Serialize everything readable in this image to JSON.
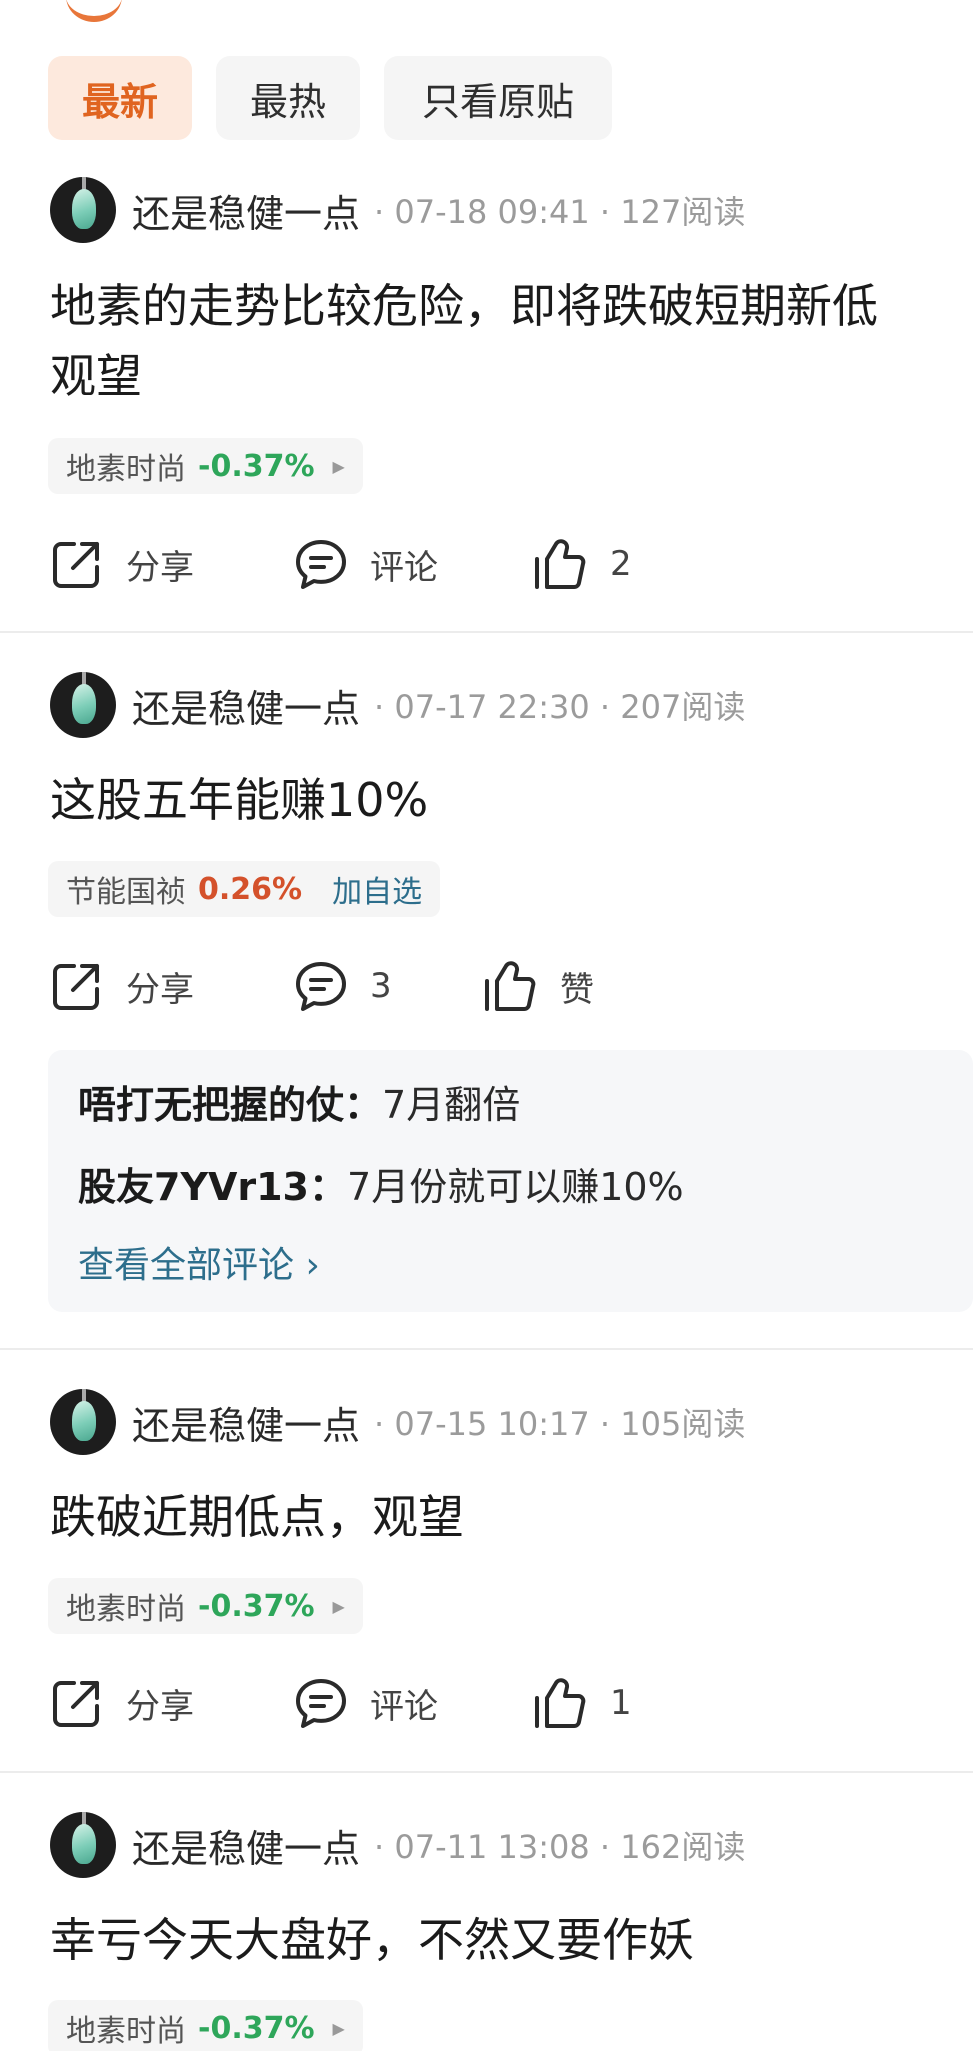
{
  "tabs": [
    {
      "label": "最新",
      "active": true
    },
    {
      "label": "最热",
      "active": false
    },
    {
      "label": "只看原贴",
      "active": false
    }
  ],
  "posts": [
    {
      "author": "还是稳健一点",
      "meta": "· 07-18 09:41 · 127阅读",
      "text_lines": [
        "地素的走势比较危险，即将跌破短期新低",
        "观望"
      ],
      "stock": {
        "name": "地素时尚",
        "change": "-0.37%",
        "direction": "down",
        "arrow": "▶"
      },
      "actions": {
        "share": "分享",
        "comment": "评论",
        "like": "2"
      }
    },
    {
      "author": "还是稳健一点",
      "meta": "· 07-17 22:30 · 207阅读",
      "text_lines": [
        "这股五年能赚10%"
      ],
      "stock": {
        "name": "节能国祯",
        "change": "0.26%",
        "direction": "up",
        "watch": "加自选"
      },
      "actions": {
        "share": "分享",
        "comment": "3",
        "like": "赞"
      },
      "comments": [
        {
          "user": "唔打无把握的仗",
          "sep": "：",
          "text": "7月翻倍"
        },
        {
          "user": "股友7YVr13",
          "sep": "：",
          "text": "7月份就可以赚10%"
        }
      ],
      "view_all": "查看全部评论 ›"
    },
    {
      "author": "还是稳健一点",
      "meta": "· 07-15 10:17 · 105阅读",
      "text_lines": [
        "跌破近期低点，观望"
      ],
      "stock": {
        "name": "地素时尚",
        "change": "-0.37%",
        "direction": "down",
        "arrow": "▶"
      },
      "actions": {
        "share": "分享",
        "comment": "评论",
        "like": "1"
      }
    },
    {
      "author": "还是稳健一点",
      "meta": "· 07-11 13:08 · 162阅读",
      "text_lines": [
        "幸亏今天大盘好，不然又要作妖"
      ],
      "stock": {
        "name": "地素时尚",
        "change": "-0.37%",
        "direction": "down",
        "arrow": "▶"
      }
    }
  ],
  "colors": {
    "accent": "#e06420",
    "down": "#2ea65a",
    "up": "#d4512b",
    "link": "#2d6e8c"
  }
}
